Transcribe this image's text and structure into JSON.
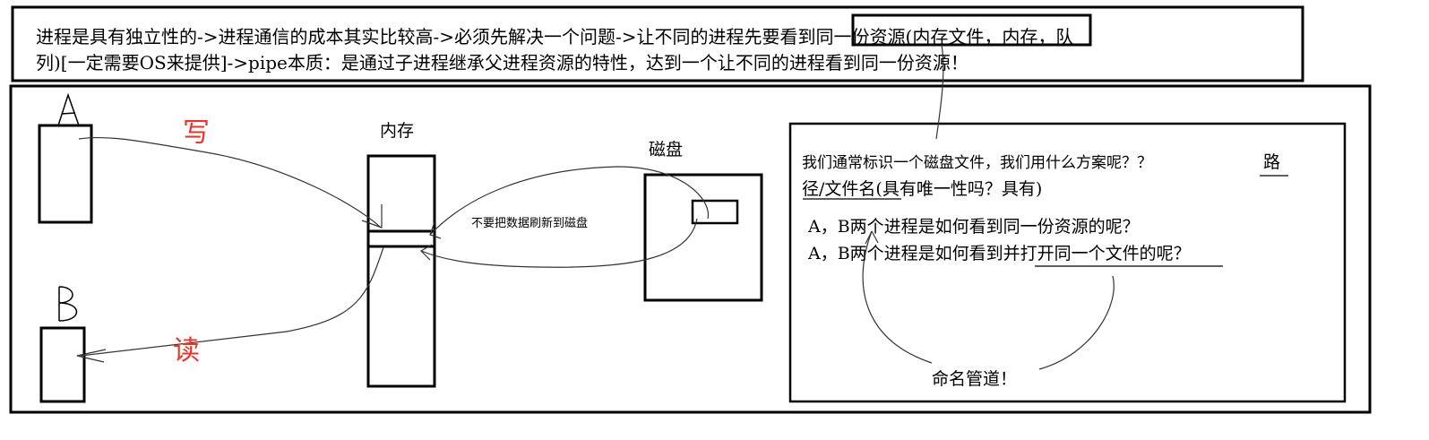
{
  "header": {
    "line1": "进程是具有独立性的->进程通信的成本其实比较高->必须先解决一个问题->让不同的进程先要看到同一份资源(内存文件，内存，队",
    "line2": "列)[一定需要OS来提供]->pipe本质：是通过子进程继承父进程资源的特性，达到一个让不同的进程看到同一份资源！"
  },
  "diagram": {
    "process_a": "A",
    "process_b": "B",
    "write_label": "写",
    "read_label": "读",
    "memory_label": "内存",
    "disk_label": "磁盘",
    "no_flush_note": "不要把数据刷新到磁盘"
  },
  "notes": {
    "q1_part1": "我们通常标识一个磁盘文件，我们用什么方案呢？？",
    "q1_part2": "路",
    "q1_line2": "径/文件名(具有唯一性吗？具有)",
    "q2": "A，B两个进程是如何看到同一份资源的呢？",
    "q3": "A，B两个进程是如何看到并打开同一个文件的呢？",
    "named_pipe": "命名管道！"
  }
}
